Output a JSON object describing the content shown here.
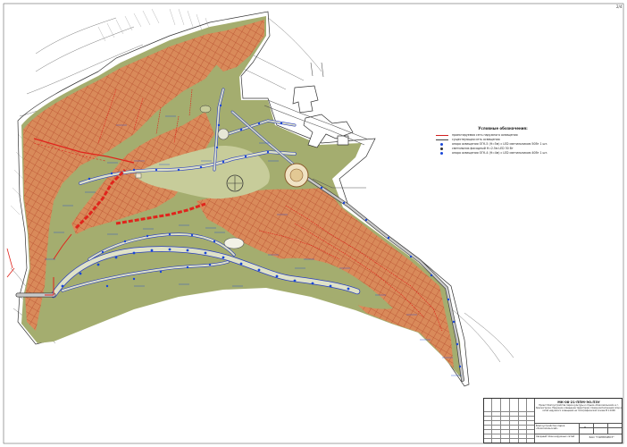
{
  "sheet_number": "2/4",
  "legend": {
    "title": "Условные обозначения:",
    "items": [
      {
        "kind": "line",
        "color": "#d21e1e",
        "label": "проектируемая сеть наружного освещения"
      },
      {
        "kind": "line",
        "color": "#555555",
        "label": "существующая сеть освещения"
      },
      {
        "kind": "dot",
        "color": "#1846d8",
        "label": "опора освещения ОГК-5 (Н=5м) с LED светильником 50Вт 1 шт."
      },
      {
        "kind": "dot",
        "color": "#333333",
        "label": "светильник фасадный Н=2.5м LED 30 Вт"
      },
      {
        "kind": "dot",
        "color": "#1846d8",
        "label": "опора освещения ОГК-4 (Н=4м) с LED светильником 40Вт 1 шт."
      }
    ]
  },
  "title_block": {
    "code": "МК-08-21-ППМ-ЭО.ПЗУ",
    "description": "Проект благоустройства парка культуры и отдыха «Комсомольский» в г. Красногорске. Наружное освещение территории. Схема расположения опор и сетей наружного освещения на топографической основе М 1:1000",
    "sheet_name": "Благоустройство парка «Комсомольский»",
    "plan_name": "Сводный план наружных сетей",
    "stage": "П",
    "org": "ЗАО \"ГОРПРОЕКТ\""
  },
  "colors": {
    "hatched_area": "#d98a5a",
    "hatch_line": "#b85030",
    "green_area": "#a4ad6f",
    "paths": "#dfe2c8",
    "path_edge": "#2a3fbf",
    "lighting_network": "#e0241c",
    "lamp": "#1846d8",
    "contour": "#7a7a7a"
  }
}
